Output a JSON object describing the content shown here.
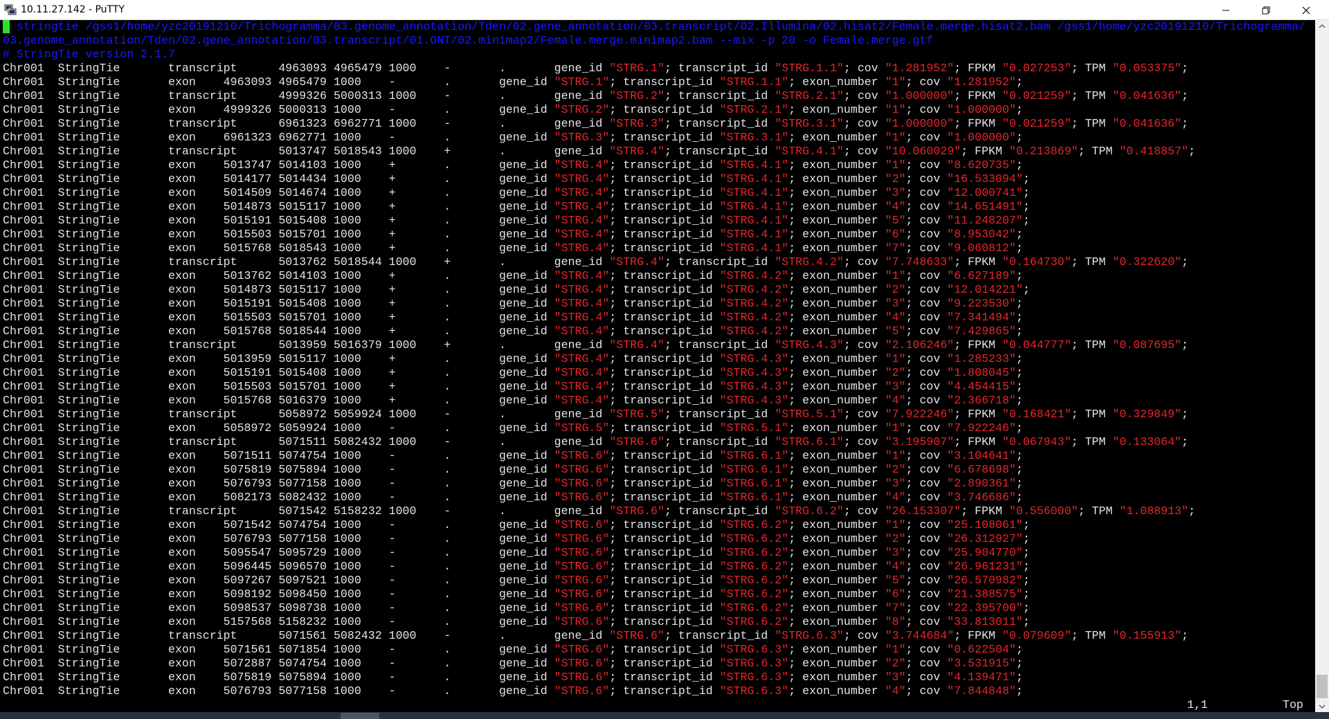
{
  "window": {
    "title": "10.11.27.142 - PuTTY",
    "app_icon": "putty-icon",
    "buttons": {
      "minimize": "minimize-icon",
      "maximize": "restore-icon",
      "close": "close-icon"
    }
  },
  "terminal": {
    "command_line_1": " stringtie /gss1/home/yzc20191210/Trichogramma/03.genome_annotation/Tden/02.gene_annotation/03.transcript/02.Illumina/02.hisat2/Female.merge.hisat2.bam /gss1/home/yzc20191210/Trichogramma/",
    "command_line_2": "03.genome_annotation/Tden/02.gene_annotation/03.transcript/01.ONT/02.minimap2/Female.merge.minimap2.bam --mix -p 20 -o Female.merge.gtf",
    "version_line": "# StringTie version 2.1.7",
    "rows": [
      {
        "chr": "Chr001",
        "src": "StringTie",
        "feat": "transcript",
        "start": "4963093",
        "end": "4965479",
        "score": "1000",
        "strand": "-",
        "gene": "STRG.1",
        "tx": "STRG.1.1",
        "cov": "1.281952",
        "fpkm": "0.027253",
        "tpm": "0.053375"
      },
      {
        "chr": "Chr001",
        "src": "StringTie",
        "feat": "exon",
        "start": "4963093",
        "end": "4965479",
        "score": "1000",
        "strand": "-",
        "gene": "STRG.1",
        "tx": "STRG.1.1",
        "exon": "1",
        "cov": "1.281952"
      },
      {
        "chr": "Chr001",
        "src": "StringTie",
        "feat": "transcript",
        "start": "4999326",
        "end": "5000313",
        "score": "1000",
        "strand": "-",
        "gene": "STRG.2",
        "tx": "STRG.2.1",
        "cov": "1.000000",
        "fpkm": "0.021259",
        "tpm": "0.041636"
      },
      {
        "chr": "Chr001",
        "src": "StringTie",
        "feat": "exon",
        "start": "4999326",
        "end": "5000313",
        "score": "1000",
        "strand": "-",
        "gene": "STRG.2",
        "tx": "STRG.2.1",
        "exon": "1",
        "cov": "1.000000"
      },
      {
        "chr": "Chr001",
        "src": "StringTie",
        "feat": "transcript",
        "start": "6961323",
        "end": "6962771",
        "score": "1000",
        "strand": "-",
        "gene": "STRG.3",
        "tx": "STRG.3.1",
        "cov": "1.000000",
        "fpkm": "0.021259",
        "tpm": "0.041636"
      },
      {
        "chr": "Chr001",
        "src": "StringTie",
        "feat": "exon",
        "start": "6961323",
        "end": "6962771",
        "score": "1000",
        "strand": "-",
        "gene": "STRG.3",
        "tx": "STRG.3.1",
        "exon": "1",
        "cov": "1.000000"
      },
      {
        "chr": "Chr001",
        "src": "StringTie",
        "feat": "transcript",
        "start": "5013747",
        "end": "5018543",
        "score": "1000",
        "strand": "+",
        "gene": "STRG.4",
        "tx": "STRG.4.1",
        "cov": "10.060029",
        "fpkm": "0.213869",
        "tpm": "0.418857"
      },
      {
        "chr": "Chr001",
        "src": "StringTie",
        "feat": "exon",
        "start": "5013747",
        "end": "5014103",
        "score": "1000",
        "strand": "+",
        "gene": "STRG.4",
        "tx": "STRG.4.1",
        "exon": "1",
        "cov": "8.620735"
      },
      {
        "chr": "Chr001",
        "src": "StringTie",
        "feat": "exon",
        "start": "5014177",
        "end": "5014434",
        "score": "1000",
        "strand": "+",
        "gene": "STRG.4",
        "tx": "STRG.4.1",
        "exon": "2",
        "cov": "16.533094"
      },
      {
        "chr": "Chr001",
        "src": "StringTie",
        "feat": "exon",
        "start": "5014509",
        "end": "5014674",
        "score": "1000",
        "strand": "+",
        "gene": "STRG.4",
        "tx": "STRG.4.1",
        "exon": "3",
        "cov": "12.000741"
      },
      {
        "chr": "Chr001",
        "src": "StringTie",
        "feat": "exon",
        "start": "5014873",
        "end": "5015117",
        "score": "1000",
        "strand": "+",
        "gene": "STRG.4",
        "tx": "STRG.4.1",
        "exon": "4",
        "cov": "14.651491"
      },
      {
        "chr": "Chr001",
        "src": "StringTie",
        "feat": "exon",
        "start": "5015191",
        "end": "5015408",
        "score": "1000",
        "strand": "+",
        "gene": "STRG.4",
        "tx": "STRG.4.1",
        "exon": "5",
        "cov": "11.248207"
      },
      {
        "chr": "Chr001",
        "src": "StringTie",
        "feat": "exon",
        "start": "5015503",
        "end": "5015701",
        "score": "1000",
        "strand": "+",
        "gene": "STRG.4",
        "tx": "STRG.4.1",
        "exon": "6",
        "cov": "8.953042"
      },
      {
        "chr": "Chr001",
        "src": "StringTie",
        "feat": "exon",
        "start": "5015768",
        "end": "5018543",
        "score": "1000",
        "strand": "+",
        "gene": "STRG.4",
        "tx": "STRG.4.1",
        "exon": "7",
        "cov": "9.060812"
      },
      {
        "chr": "Chr001",
        "src": "StringTie",
        "feat": "transcript",
        "start": "5013762",
        "end": "5018544",
        "score": "1000",
        "strand": "+",
        "gene": "STRG.4",
        "tx": "STRG.4.2",
        "cov": "7.748633",
        "fpkm": "0.164730",
        "tpm": "0.322620"
      },
      {
        "chr": "Chr001",
        "src": "StringTie",
        "feat": "exon",
        "start": "5013762",
        "end": "5014103",
        "score": "1000",
        "strand": "+",
        "gene": "STRG.4",
        "tx": "STRG.4.2",
        "exon": "1",
        "cov": "6.627189"
      },
      {
        "chr": "Chr001",
        "src": "StringTie",
        "feat": "exon",
        "start": "5014873",
        "end": "5015117",
        "score": "1000",
        "strand": "+",
        "gene": "STRG.4",
        "tx": "STRG.4.2",
        "exon": "2",
        "cov": "12.014221"
      },
      {
        "chr": "Chr001",
        "src": "StringTie",
        "feat": "exon",
        "start": "5015191",
        "end": "5015408",
        "score": "1000",
        "strand": "+",
        "gene": "STRG.4",
        "tx": "STRG.4.2",
        "exon": "3",
        "cov": "9.223530"
      },
      {
        "chr": "Chr001",
        "src": "StringTie",
        "feat": "exon",
        "start": "5015503",
        "end": "5015701",
        "score": "1000",
        "strand": "+",
        "gene": "STRG.4",
        "tx": "STRG.4.2",
        "exon": "4",
        "cov": "7.341494"
      },
      {
        "chr": "Chr001",
        "src": "StringTie",
        "feat": "exon",
        "start": "5015768",
        "end": "5018544",
        "score": "1000",
        "strand": "+",
        "gene": "STRG.4",
        "tx": "STRG.4.2",
        "exon": "5",
        "cov": "7.429865"
      },
      {
        "chr": "Chr001",
        "src": "StringTie",
        "feat": "transcript",
        "start": "5013959",
        "end": "5016379",
        "score": "1000",
        "strand": "+",
        "gene": "STRG.4",
        "tx": "STRG.4.3",
        "cov": "2.106246",
        "fpkm": "0.044777",
        "tpm": "0.087695"
      },
      {
        "chr": "Chr001",
        "src": "StringTie",
        "feat": "exon",
        "start": "5013959",
        "end": "5015117",
        "score": "1000",
        "strand": "+",
        "gene": "STRG.4",
        "tx": "STRG.4.3",
        "exon": "1",
        "cov": "1.285233"
      },
      {
        "chr": "Chr001",
        "src": "StringTie",
        "feat": "exon",
        "start": "5015191",
        "end": "5015408",
        "score": "1000",
        "strand": "+",
        "gene": "STRG.4",
        "tx": "STRG.4.3",
        "exon": "2",
        "cov": "1.808045"
      },
      {
        "chr": "Chr001",
        "src": "StringTie",
        "feat": "exon",
        "start": "5015503",
        "end": "5015701",
        "score": "1000",
        "strand": "+",
        "gene": "STRG.4",
        "tx": "STRG.4.3",
        "exon": "3",
        "cov": "4.454415"
      },
      {
        "chr": "Chr001",
        "src": "StringTie",
        "feat": "exon",
        "start": "5015768",
        "end": "5016379",
        "score": "1000",
        "strand": "+",
        "gene": "STRG.4",
        "tx": "STRG.4.3",
        "exon": "4",
        "cov": "2.366718"
      },
      {
        "chr": "Chr001",
        "src": "StringTie",
        "feat": "transcript",
        "start": "5058972",
        "end": "5059924",
        "score": "1000",
        "strand": "-",
        "gene": "STRG.5",
        "tx": "STRG.5.1",
        "cov": "7.922246",
        "fpkm": "0.168421",
        "tpm": "0.329849"
      },
      {
        "chr": "Chr001",
        "src": "StringTie",
        "feat": "exon",
        "start": "5058972",
        "end": "5059924",
        "score": "1000",
        "strand": "-",
        "gene": "STRG.5",
        "tx": "STRG.5.1",
        "exon": "1",
        "cov": "7.922246"
      },
      {
        "chr": "Chr001",
        "src": "StringTie",
        "feat": "transcript",
        "start": "5071511",
        "end": "5082432",
        "score": "1000",
        "strand": "-",
        "gene": "STRG.6",
        "tx": "STRG.6.1",
        "cov": "3.195907",
        "fpkm": "0.067943",
        "tpm": "0.133064"
      },
      {
        "chr": "Chr001",
        "src": "StringTie",
        "feat": "exon",
        "start": "5071511",
        "end": "5074754",
        "score": "1000",
        "strand": "-",
        "gene": "STRG.6",
        "tx": "STRG.6.1",
        "exon": "1",
        "cov": "3.104641"
      },
      {
        "chr": "Chr001",
        "src": "StringTie",
        "feat": "exon",
        "start": "5075819",
        "end": "5075894",
        "score": "1000",
        "strand": "-",
        "gene": "STRG.6",
        "tx": "STRG.6.1",
        "exon": "2",
        "cov": "6.678698"
      },
      {
        "chr": "Chr001",
        "src": "StringTie",
        "feat": "exon",
        "start": "5076793",
        "end": "5077158",
        "score": "1000",
        "strand": "-",
        "gene": "STRG.6",
        "tx": "STRG.6.1",
        "exon": "3",
        "cov": "2.890361"
      },
      {
        "chr": "Chr001",
        "src": "StringTie",
        "feat": "exon",
        "start": "5082173",
        "end": "5082432",
        "score": "1000",
        "strand": "-",
        "gene": "STRG.6",
        "tx": "STRG.6.1",
        "exon": "4",
        "cov": "3.746686"
      },
      {
        "chr": "Chr001",
        "src": "StringTie",
        "feat": "transcript",
        "start": "5071542",
        "end": "5158232",
        "score": "1000",
        "strand": "-",
        "gene": "STRG.6",
        "tx": "STRG.6.2",
        "cov": "26.153307",
        "fpkm": "0.556000",
        "tpm": "1.088913"
      },
      {
        "chr": "Chr001",
        "src": "StringTie",
        "feat": "exon",
        "start": "5071542",
        "end": "5074754",
        "score": "1000",
        "strand": "-",
        "gene": "STRG.6",
        "tx": "STRG.6.2",
        "exon": "1",
        "cov": "25.108061"
      },
      {
        "chr": "Chr001",
        "src": "StringTie",
        "feat": "exon",
        "start": "5076793",
        "end": "5077158",
        "score": "1000",
        "strand": "-",
        "gene": "STRG.6",
        "tx": "STRG.6.2",
        "exon": "2",
        "cov": "26.312927"
      },
      {
        "chr": "Chr001",
        "src": "StringTie",
        "feat": "exon",
        "start": "5095547",
        "end": "5095729",
        "score": "1000",
        "strand": "-",
        "gene": "STRG.6",
        "tx": "STRG.6.2",
        "exon": "3",
        "cov": "25.904770"
      },
      {
        "chr": "Chr001",
        "src": "StringTie",
        "feat": "exon",
        "start": "5096445",
        "end": "5096570",
        "score": "1000",
        "strand": "-",
        "gene": "STRG.6",
        "tx": "STRG.6.2",
        "exon": "4",
        "cov": "26.961231"
      },
      {
        "chr": "Chr001",
        "src": "StringTie",
        "feat": "exon",
        "start": "5097267",
        "end": "5097521",
        "score": "1000",
        "strand": "-",
        "gene": "STRG.6",
        "tx": "STRG.6.2",
        "exon": "5",
        "cov": "26.570982"
      },
      {
        "chr": "Chr001",
        "src": "StringTie",
        "feat": "exon",
        "start": "5098192",
        "end": "5098450",
        "score": "1000",
        "strand": "-",
        "gene": "STRG.6",
        "tx": "STRG.6.2",
        "exon": "6",
        "cov": "21.388575"
      },
      {
        "chr": "Chr001",
        "src": "StringTie",
        "feat": "exon",
        "start": "5098537",
        "end": "5098738",
        "score": "1000",
        "strand": "-",
        "gene": "STRG.6",
        "tx": "STRG.6.2",
        "exon": "7",
        "cov": "22.395700"
      },
      {
        "chr": "Chr001",
        "src": "StringTie",
        "feat": "exon",
        "start": "5157568",
        "end": "5158232",
        "score": "1000",
        "strand": "-",
        "gene": "STRG.6",
        "tx": "STRG.6.2",
        "exon": "8",
        "cov": "33.813011"
      },
      {
        "chr": "Chr001",
        "src": "StringTie",
        "feat": "transcript",
        "start": "5071561",
        "end": "5082432",
        "score": "1000",
        "strand": "-",
        "gene": "STRG.6",
        "tx": "STRG.6.3",
        "cov": "3.744684",
        "fpkm": "0.079609",
        "tpm": "0.155913"
      },
      {
        "chr": "Chr001",
        "src": "StringTie",
        "feat": "exon",
        "start": "5071561",
        "end": "5071854",
        "score": "1000",
        "strand": "-",
        "gene": "STRG.6",
        "tx": "STRG.6.3",
        "exon": "1",
        "cov": "0.622504"
      },
      {
        "chr": "Chr001",
        "src": "StringTie",
        "feat": "exon",
        "start": "5072887",
        "end": "5074754",
        "score": "1000",
        "strand": "-",
        "gene": "STRG.6",
        "tx": "STRG.6.3",
        "exon": "2",
        "cov": "3.531915"
      },
      {
        "chr": "Chr001",
        "src": "StringTie",
        "feat": "exon",
        "start": "5075819",
        "end": "5075894",
        "score": "1000",
        "strand": "-",
        "gene": "STRG.6",
        "tx": "STRG.6.3",
        "exon": "3",
        "cov": "4.139471"
      },
      {
        "chr": "Chr001",
        "src": "StringTie",
        "feat": "exon",
        "start": "5076793",
        "end": "5077158",
        "score": "1000",
        "strand": "-",
        "gene": "STRG.6",
        "tx": "STRG.6.3",
        "exon": "4",
        "cov": "7.844848"
      }
    ]
  },
  "status": {
    "position": "1,1",
    "scroll": "Top"
  },
  "colors": {
    "background": "#000000",
    "text": "#e6e6e6",
    "quoted_value": "#e6262c",
    "command": "#1a1aff",
    "cursor": "#2ae02a"
  }
}
